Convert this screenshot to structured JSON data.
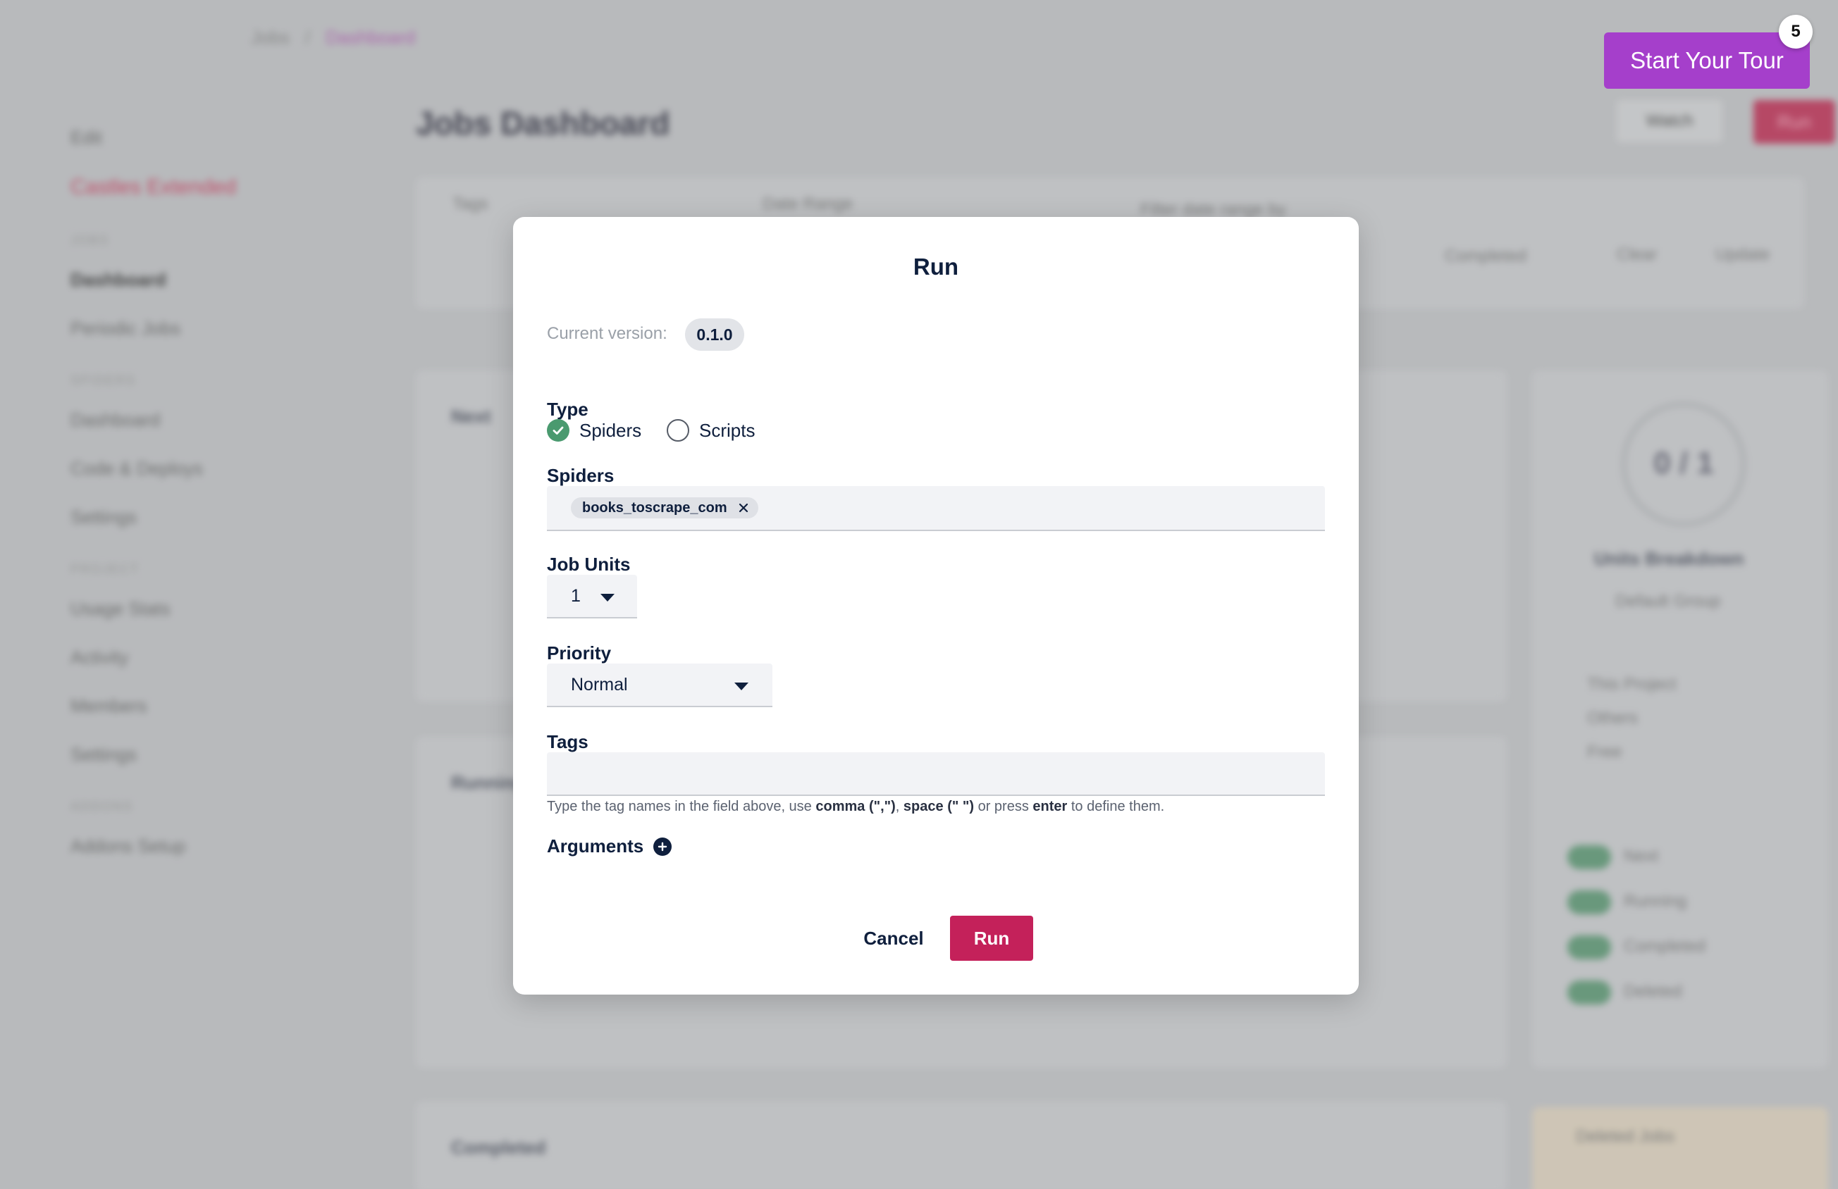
{
  "background": {
    "breadcrumb": [
      "Jobs",
      "/",
      "Dashboard"
    ],
    "sidebar": {
      "top": [
        "Edit",
        "Castles Extended"
      ],
      "groups": [
        {
          "title": "JOBS",
          "items": [
            "Dashboard",
            "Periodic Jobs"
          ]
        },
        {
          "title": "SPIDERS",
          "items": [
            "Dashboard",
            "Code & Deploys",
            "Settings"
          ]
        },
        {
          "title": "PROJECT",
          "items": [
            "Usage Stats",
            "Activity",
            "Members",
            "Settings"
          ]
        },
        {
          "title": "ADDONS",
          "items": [
            "Addons Setup"
          ]
        }
      ]
    },
    "page_title": "Jobs Dashboard",
    "watch_label": "Watch",
    "run_label": "Run",
    "filter_labels": [
      "Tags",
      "Date Range",
      "Filter date range by",
      "Completed",
      "Clear",
      "Update"
    ],
    "section_titles": [
      "Next",
      "Running",
      "Completed"
    ],
    "units_circle": "0 / 1",
    "units_title": "Units Breakdown",
    "units_link": "Default Group",
    "units_rows": [
      "This Project",
      "Others",
      "Free"
    ],
    "toggle_rows": [
      "Next",
      "Running",
      "Completed",
      "Deleted"
    ],
    "deleted_box_title": "Deleted Jobs"
  },
  "tour": {
    "label": "Start Your Tour",
    "badge": "5"
  },
  "modal": {
    "title": "Run",
    "version_label": "Current version:",
    "version_value": "0.1.0",
    "type_label": "Type",
    "type_options": [
      {
        "label": "Spiders",
        "checked": true
      },
      {
        "label": "Scripts",
        "checked": false
      }
    ],
    "spiders_label": "Spiders",
    "spider_chip": "books_toscrape_com",
    "job_units_label": "Job Units",
    "job_units_value": "1",
    "priority_label": "Priority",
    "priority_value": "Normal",
    "tags_label": "Tags",
    "tags_value": "",
    "help_parts": [
      "Type the tag names in the field above, use ",
      "comma (\",\")",
      ", ",
      "space (\" \")",
      " or press ",
      "enter",
      " to define them."
    ],
    "arguments_label": "Arguments",
    "cancel_label": "Cancel",
    "run_label": "Run"
  },
  "colors": {
    "accent_run": "#c4215a",
    "tour_purple": "#a53fcb",
    "check_green": "#4a9a6f",
    "text_navy": "#0f1f3d"
  },
  "icons": {
    "check": "check-icon",
    "close": "close-icon",
    "dropdown": "caret-down-icon",
    "add": "plus-circle-icon"
  }
}
